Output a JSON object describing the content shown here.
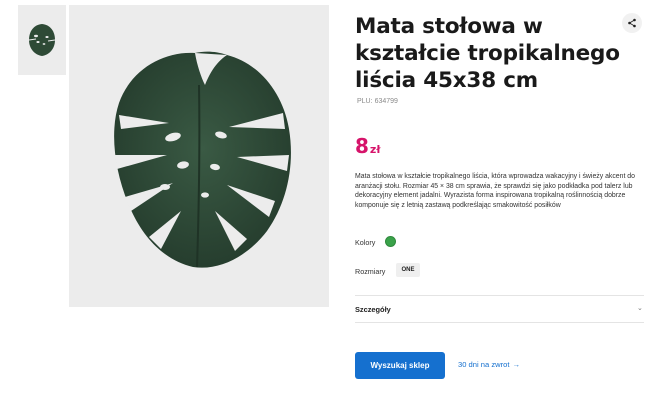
{
  "product": {
    "title": "Mata stołowa w kształcie tropikalnego liścia 45x38 cm",
    "plu_label": "PLU:",
    "plu_value": "634799",
    "price_amount": "8",
    "price_currency": "zł",
    "description": "Mata stołowa w kształcie tropikalnego liścia, która wprowadza wakacyjny i świeży akcent do aranżacji stołu. Rozmiar 45 × 38 cm sprawia, że sprawdzi się jako podkładka pod talerz lub dekoracyjny element jadalni. Wyrazista forma inspirowana tropikalną roślinnością dobrze komponuje się z letnią zastawą podkreślając smakowitość posiłków"
  },
  "options": {
    "colors_label": "Kolory",
    "color_swatch": "#3aa24a",
    "sizes_label": "Rozmiary",
    "size_value": "ONE"
  },
  "details": {
    "label": "Szczegóły",
    "chevron_icon": "chevron-down-icon"
  },
  "actions": {
    "search_store": "Wyszukaj sklep",
    "return_link": "30 dni na zwrot",
    "return_arrow": "→",
    "share_icon": "share-icon"
  },
  "colors": {
    "brand_blue": "#1570cf",
    "price_pink": "#d6136a",
    "leaf_green": "#2e4a36",
    "gallery_bg": "#ececec"
  }
}
